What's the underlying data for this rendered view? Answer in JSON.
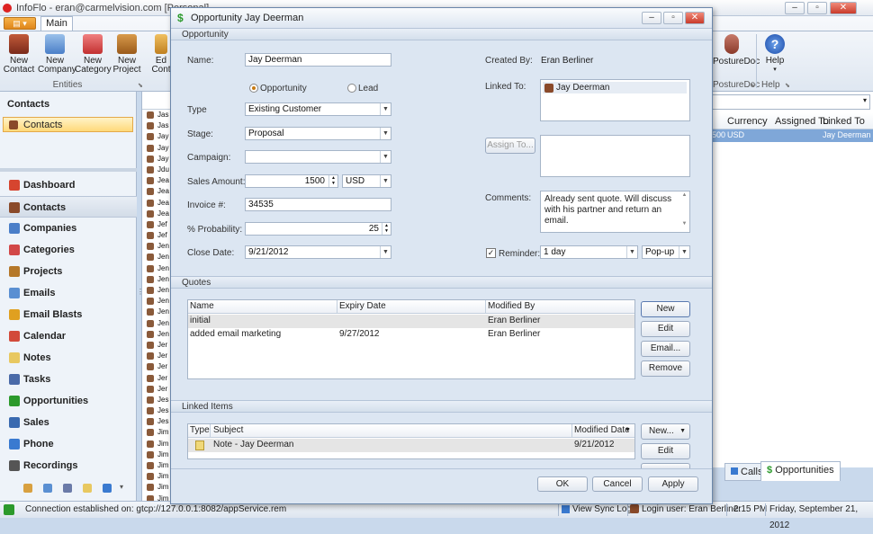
{
  "app": {
    "title": "InfoFlo - eran@carmelvision.com [Personal]",
    "tab_main": "Main"
  },
  "ribbon": {
    "buttons": [
      {
        "label1": "New",
        "label2": "Contact"
      },
      {
        "label1": "New",
        "label2": "Company"
      },
      {
        "label1": "New",
        "label2": "Category"
      },
      {
        "label1": "New",
        "label2": "Project"
      },
      {
        "label1": "Ed",
        "label2": "Cont"
      }
    ],
    "group_entities": "Entities",
    "posturedoc": "PostureDoc",
    "posturedoc_group": "PostureDoc",
    "help": "Help",
    "help_group": "Help"
  },
  "leftnav": {
    "header": "Contacts",
    "selected_folder": "Contacts",
    "items": [
      {
        "label": "Dashboard",
        "color": "#d6452f"
      },
      {
        "label": "Contacts",
        "color": "#8a4a2a"
      },
      {
        "label": "Companies",
        "color": "#4a7ec8"
      },
      {
        "label": "Categories",
        "color": "#d24848"
      },
      {
        "label": "Projects",
        "color": "#b5782a"
      },
      {
        "label": "Emails",
        "color": "#5a8fd2"
      },
      {
        "label": "Email Blasts",
        "color": "#e0a020"
      },
      {
        "label": "Calendar",
        "color": "#d24a3a"
      },
      {
        "label": "Notes",
        "color": "#e8c860"
      },
      {
        "label": "Tasks",
        "color": "#4a6aa8"
      },
      {
        "label": "Opportunities",
        "color": "#2c9a2c"
      },
      {
        "label": "Sales",
        "color": "#3a6ab0"
      },
      {
        "label": "Phone",
        "color": "#3a7ad0"
      },
      {
        "label": "Recordings",
        "color": "#555555"
      }
    ]
  },
  "midlist": {
    "rows": [
      "Jas",
      "Jas",
      "Jay",
      "Jay",
      "Jay",
      "Jdu",
      "Jea",
      "Jea",
      "Jea",
      "Jea",
      "Jef",
      "Jef",
      "Jen",
      "Jen",
      "Jen",
      "Jen",
      "Jen",
      "Jen",
      "Jen",
      "Jen",
      "Jen",
      "Jer",
      "Jer",
      "Jer",
      "Jer",
      "Jer",
      "Jes",
      "Jes",
      "Jes",
      "Jim",
      "Jim",
      "Jim",
      "Jim",
      "Jim",
      "Jim",
      "Jim"
    ]
  },
  "rgrid": {
    "columns": [
      "Currency",
      "Assigned To",
      "Linked To"
    ],
    "selected_row": {
      "amount": "500",
      "currency": "USD",
      "assigned": "",
      "linked": "Jay Deerman"
    }
  },
  "bottomtabs": {
    "calls": "Calls",
    "opportunities": "Opportunities"
  },
  "status": {
    "connection": "Connection established on: gtcp://127.0.0.1:8082/appService.rem",
    "sync": "View Sync Log",
    "user": "Login user: Eran Berliner",
    "time": "2:15 PM",
    "date": "Friday, September 21, 2012"
  },
  "dialog": {
    "title": "Opportunity Jay Deerman",
    "section_opportunity": "Opportunity",
    "name_label": "Name:",
    "name_value": "Jay Deerman",
    "radio_opportunity": "Opportunity",
    "radio_lead": "Lead",
    "type_label": "Type",
    "type_value": "Existing Customer",
    "stage_label": "Stage:",
    "stage_value": "Proposal",
    "campaign_label": "Campaign:",
    "campaign_value": "",
    "sales_label": "Sales Amount:",
    "sales_value": "1500",
    "currency_value": "USD",
    "invoice_label": "Invoice #:",
    "invoice_value": "34535",
    "prob_label": "% Probability:",
    "prob_value": "25",
    "close_label": "Close Date:",
    "close_value": "9/21/2012",
    "createdby_label": "Created By:",
    "createdby_value": "Eran Berliner",
    "linked_label": "Linked To:",
    "linked_value": "Jay Deerman",
    "assign_button": "Assign To...",
    "comments_label": "Comments:",
    "comments_value": "Already sent quote. Will discuss with his partner and return an email.",
    "reminder_label": "Reminder:",
    "reminder_value": "1 day",
    "reminder_type": "Pop-up",
    "section_quotes": "Quotes",
    "quotes_columns": [
      "Name",
      "Expiry Date",
      "Modified By"
    ],
    "quotes_rows": [
      {
        "name": "initial",
        "expiry": "",
        "modified": "Eran Berliner"
      },
      {
        "name": "added email marketing",
        "expiry": "9/27/2012",
        "modified": "Eran Berliner"
      }
    ],
    "quote_buttons": [
      "New",
      "Edit",
      "Email...",
      "Remove"
    ],
    "section_linked": "Linked Items",
    "linked_columns": [
      "Type",
      "Subject",
      "Modified Date"
    ],
    "linked_rows": [
      {
        "subject": "Note - Jay Deerman",
        "date": "9/21/2012"
      }
    ],
    "linked_buttons": [
      "New...",
      "Edit"
    ],
    "ok": "OK",
    "cancel": "Cancel",
    "apply": "Apply"
  }
}
